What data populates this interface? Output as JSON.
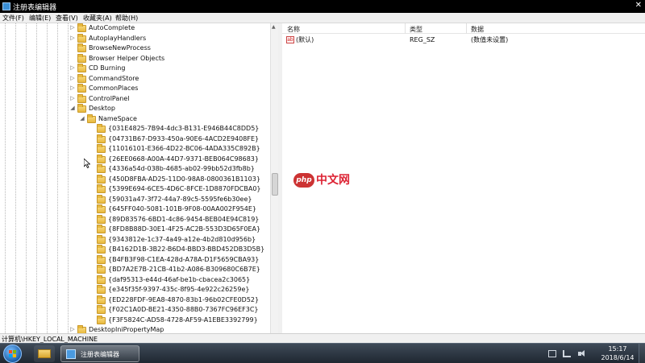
{
  "window": {
    "title": "注册表编辑器"
  },
  "menu": [
    "文件(F)",
    "编辑(E)",
    "查看(V)",
    "收藏夹(A)",
    "帮助(H)"
  ],
  "tree": {
    "siblings": [
      "AutoComplete",
      "AutoplayHandlers",
      "BrowseNewProcess",
      "Browser Helper Objects",
      "CD Burning",
      "CommandStore",
      "CommonPlaces",
      "ControlPanel"
    ],
    "expanded": "Desktop",
    "child": "NameSpace",
    "guids": [
      "{031E4825-7B94-4dc3-B131-E946B44C8DD5}",
      "{04731B67-D933-450a-90E6-4ACD2E9408FE}",
      "{11016101-E366-4D22-BC06-4ADA335C892B}",
      "{26EE0668-A00A-44D7-9371-BEB064C98683}",
      "{4336a54d-038b-4685-ab02-99bb52d3fb8b}",
      "{450D8FBA-AD25-11D0-98A8-0800361B1103}",
      "{5399E694-6CE5-4D6C-8FCE-1D8870FDCBA0}",
      "{59031a47-3f72-44a7-89c5-5595fe6b30ee}",
      "{645FF040-5081-101B-9F08-00AA002F954E}",
      "{89D83576-6BD1-4c86-9454-BEB04E94C819}",
      "{8FD8B88D-30E1-4F25-AC2B-553D3D65F0EA}",
      "{9343812e-1c37-4a49-a12e-4b2d810d956b}",
      "{B4162D1B-3B22-B6D4-BBD3-BBD452DB3D5B}",
      "{B4FB3F98-C1EA-428d-A78A-D1F5659CBA93}",
      "{BD7A2E7B-21CB-41b2-A086-B309680C6B7E}",
      "{daf95313-e44d-46af-be1b-cbacea2c3065}",
      "{e345f35f-9397-435c-8f95-4e922c26259e}",
      "{ED228FDF-9EA8-4870-83b1-96b02CFE0D52}",
      "{F02C1A0D-BE21-4350-88B0-7367FC96EF3C}",
      "{F3F5824C-AD58-4728-AF59-A1EBE3392799}"
    ],
    "after": "DesktopIniPropertyMap"
  },
  "list": {
    "headers": {
      "name": "名称",
      "type": "类型",
      "data": "数据"
    },
    "rows": [
      {
        "name": "(默认)",
        "type": "REG_SZ",
        "data": "(数值未设置)"
      }
    ]
  },
  "watermark": {
    "badge": "php",
    "text": "中文网"
  },
  "status": {
    "path": "计算机\\HKEY_LOCAL_MACHINE"
  },
  "taskbar": {
    "active_app": "注册表编辑器",
    "time": "15:17",
    "date": "2018/6/14"
  },
  "colors": {
    "watermark": "#d22233",
    "folder": "#e8b93e",
    "taskbar": "#2a3440"
  }
}
